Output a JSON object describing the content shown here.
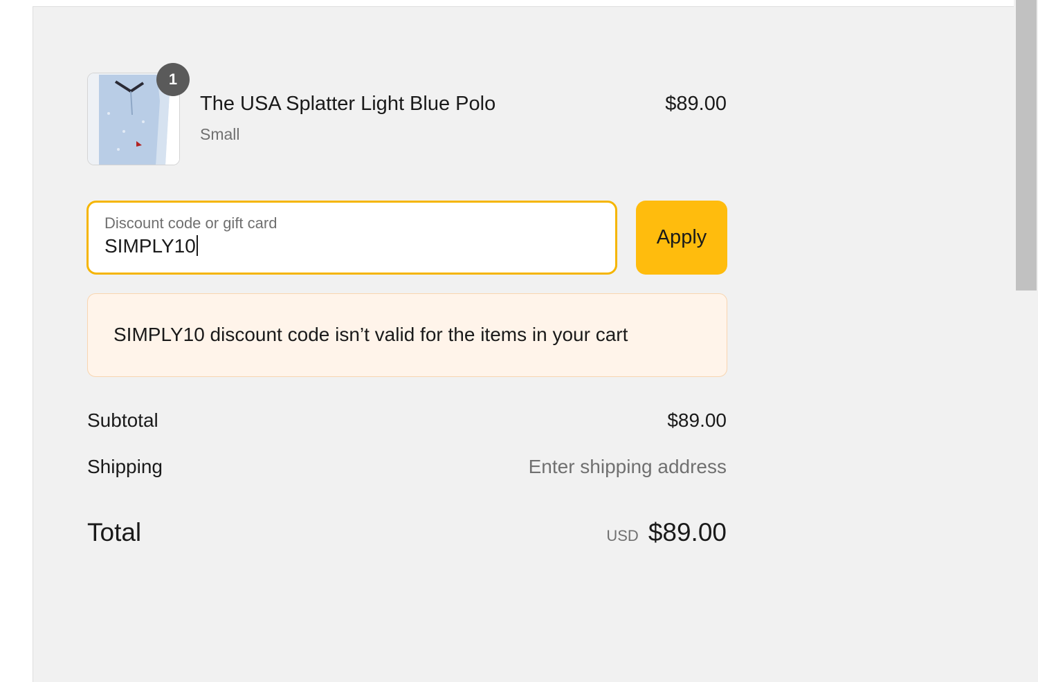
{
  "order": {
    "item": {
      "quantity": "1",
      "name": "The USA Splatter Light Blue Polo",
      "variant": "Small",
      "price": "$89.00",
      "image_icon": "polo-shirt-image"
    },
    "discount": {
      "label": "Discount code or gift card",
      "value": "SIMPLY10",
      "apply_label": "Apply",
      "error": "SIMPLY10 discount code isn’t valid for the items in your cart"
    },
    "summary": {
      "subtotal_label": "Subtotal",
      "subtotal_value": "$89.00",
      "shipping_label": "Shipping",
      "shipping_value": "Enter shipping address",
      "total_label": "Total",
      "currency": "USD",
      "total_value": "$89.00"
    }
  },
  "colors": {
    "accent": "#ffbc0d",
    "focus_border": "#f5b500",
    "error_background": "#fff4ea",
    "panel_background": "#f1f1f1"
  }
}
